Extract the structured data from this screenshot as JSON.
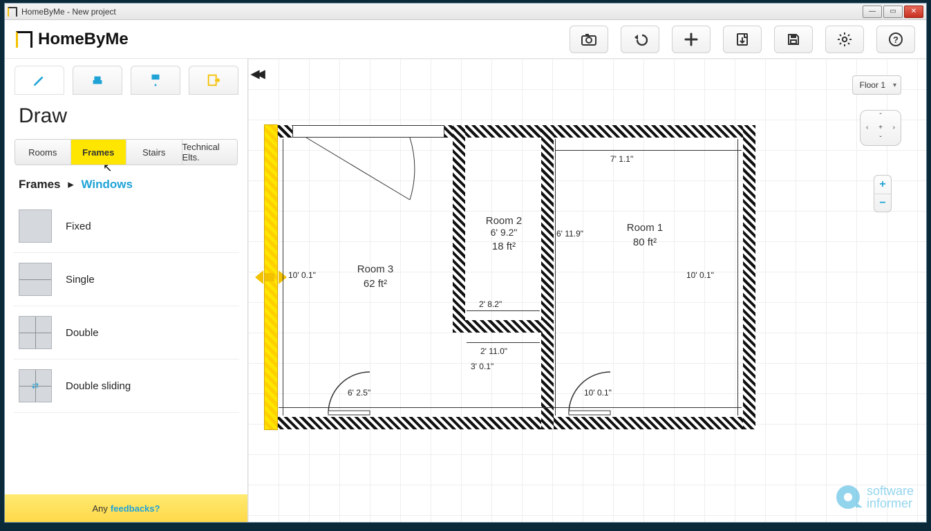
{
  "window": {
    "title": "HomeByMe - New project"
  },
  "brand": {
    "name": "HomeByMe"
  },
  "toolbar": {
    "camera": "camera-icon",
    "undo": "undo-icon",
    "add": "plus-icon",
    "export": "file-export-icon",
    "save": "save-icon",
    "settings": "gear-icon",
    "help": "help-icon"
  },
  "sidebar": {
    "section_title": "Draw",
    "mode_tabs": [
      "draw",
      "furnish",
      "paint",
      "share"
    ],
    "category_tabs": [
      {
        "label": "Rooms",
        "active": false
      },
      {
        "label": "Frames",
        "active": true
      },
      {
        "label": "Stairs",
        "active": false
      },
      {
        "label": "Technical Elts.",
        "active": false
      }
    ],
    "breadcrumb": {
      "root": "Frames",
      "sub": "Windows"
    },
    "items": [
      {
        "label": "Fixed"
      },
      {
        "label": "Single"
      },
      {
        "label": "Double"
      },
      {
        "label": "Double sliding"
      }
    ],
    "feedback_prefix": "Any ",
    "feedback_link": "feedbacks?"
  },
  "canvas": {
    "floor_selector": "Floor 1",
    "rooms": [
      {
        "name": "Room 1",
        "area": "80 ft²"
      },
      {
        "name": "Room 2",
        "width": "6' 9.2\"",
        "area": "18 ft²"
      },
      {
        "name": "Room 3",
        "area": "62 ft²"
      }
    ],
    "dimensions": {
      "room3_height": "10' 0.1\"",
      "room1_top": "7' 1.1\"",
      "room1_left_height": "6' 11.9\"",
      "room1_right_height": "10' 0.1\"",
      "room2_bottom": "2' 8.2\"",
      "hall_width": "2' 11.0\"",
      "hall_below": "3' 0.1\"",
      "door_left": "6' 2.5\"",
      "door_right": "10' 0.1\""
    }
  },
  "watermark": {
    "line1": "software",
    "line2": "informer"
  }
}
